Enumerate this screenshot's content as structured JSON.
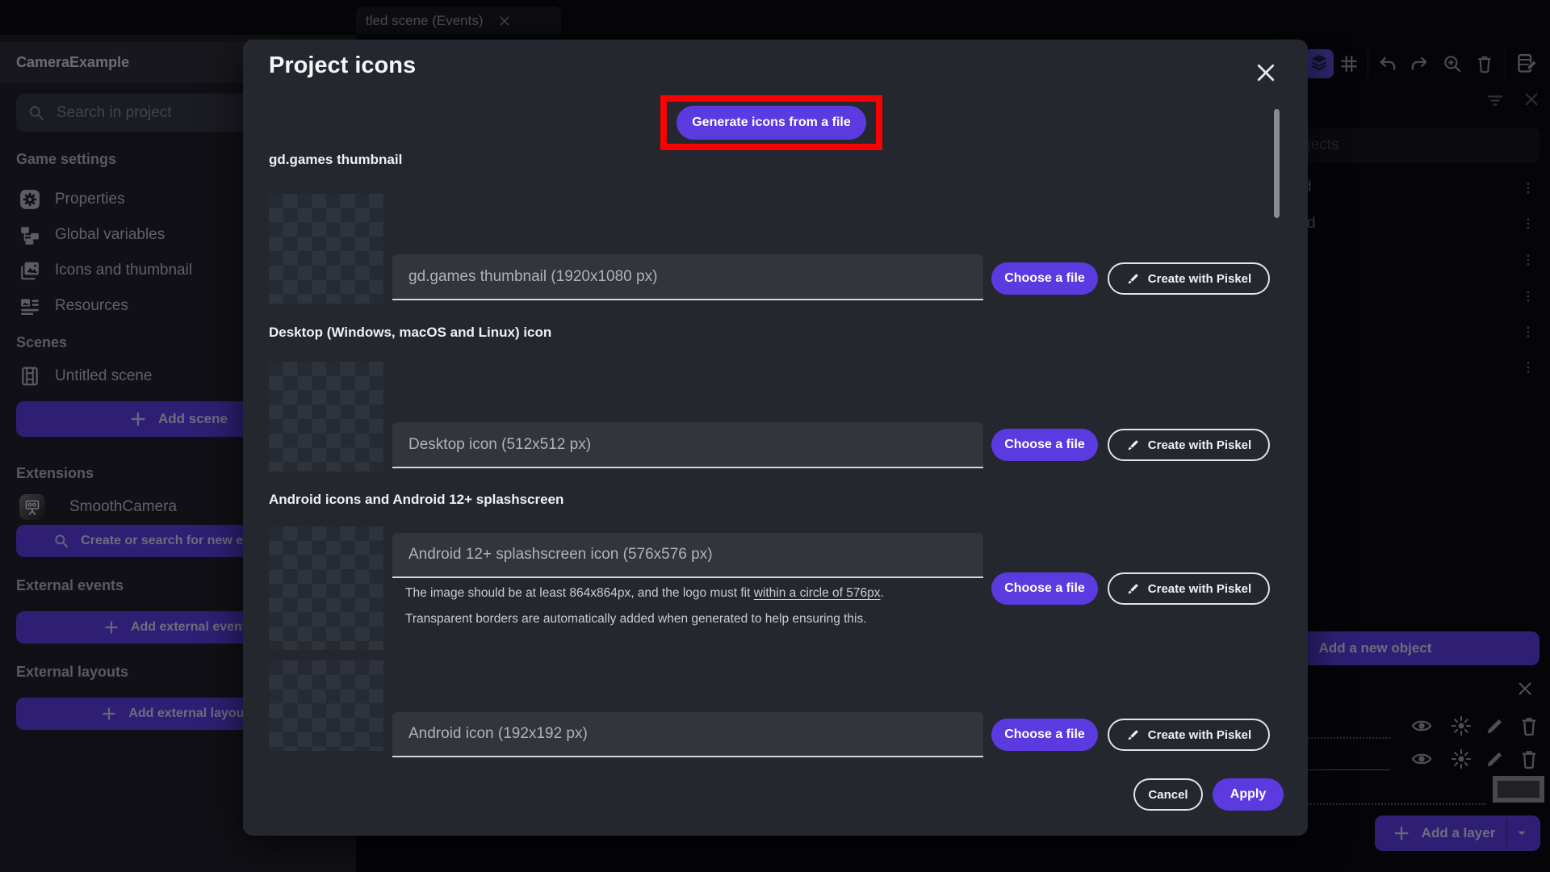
{
  "topbar": {
    "tab_label": "tled scene (Events)"
  },
  "sidebar": {
    "project_name": "CameraExample",
    "search_placeholder": "Search in project",
    "game_settings": {
      "title": "Game settings",
      "items": [
        {
          "label": "Properties"
        },
        {
          "label": "Global variables"
        },
        {
          "label": "Icons and thumbnail"
        },
        {
          "label": "Resources"
        }
      ]
    },
    "scenes": {
      "title": "Scenes",
      "items": [
        {
          "label": "Untitled scene"
        }
      ],
      "add_button": "Add scene"
    },
    "extensions": {
      "title": "Extensions",
      "items": [
        {
          "label": "SmoothCamera"
        }
      ],
      "search_button": "Create or search for new extensions"
    },
    "external_events": {
      "title": "External events",
      "add_button": "Add external events"
    },
    "external_layouts": {
      "title": "External layouts",
      "add_button": "Add external layouts"
    }
  },
  "objects_panel": {
    "search_placeholder": "Search objects",
    "rows": [
      {
        "label_fragment": "d"
      },
      {
        "label_fragment": "d"
      }
    ],
    "add_object_button": "Add a new object"
  },
  "layers_panel": {
    "add_layer_button": "Add a layer"
  },
  "modal": {
    "title": "Project icons",
    "generate_button": "Generate icons from a file",
    "buttons": {
      "choose": "Choose a file",
      "piskel": "Create with Piskel"
    },
    "sections": [
      {
        "heading": "gd.games thumbnail",
        "placeholder": "gd.games thumbnail (1920x1080 px)"
      },
      {
        "heading": "Desktop (Windows, macOS and Linux) icon",
        "placeholder": "Desktop icon (512x512 px)"
      },
      {
        "heading": "Android icons and Android 12+ splashscreen",
        "placeholder": "Android 12+ splashscreen icon (576x576 px)",
        "helper_pre": "The image should be at least 864x864px, and the logo must fit ",
        "helper_link": "within a circle of 576px",
        "helper_post": ".",
        "helper_line2": "Transparent borders are automatically added when generated to help ensuring this."
      },
      {
        "placeholder": "Android icon (192x192 px)"
      }
    ],
    "footer": {
      "cancel": "Cancel",
      "apply": "Apply"
    }
  },
  "icons": {
    "search": "magnifier",
    "close": "x-cross",
    "plus": "+",
    "kebab": "vertical-dots",
    "eye": "visibility",
    "sun": "effects-rays",
    "pencil": "edit",
    "trash": "delete",
    "caret_down": "triangle-down",
    "brush": "piskel-paintbrush",
    "layers": "stacked-layers",
    "grid": "hash-grid",
    "undo": "curved-arrow-left",
    "redo": "curved-arrow-right",
    "zoom_in": "magnifier-plus",
    "notebook_edit": "sheet-with-pencil",
    "filter": "funnel-lines"
  },
  "colors": {
    "primary_purple": "#5b3ae0",
    "highlight_red": "#fa0000",
    "modal_bg": "#25272f",
    "input_bg": "#33353d",
    "sidebar_bg": "#1c1c24",
    "checker_light": "#2e333c",
    "checker_dark": "#262b33"
  }
}
